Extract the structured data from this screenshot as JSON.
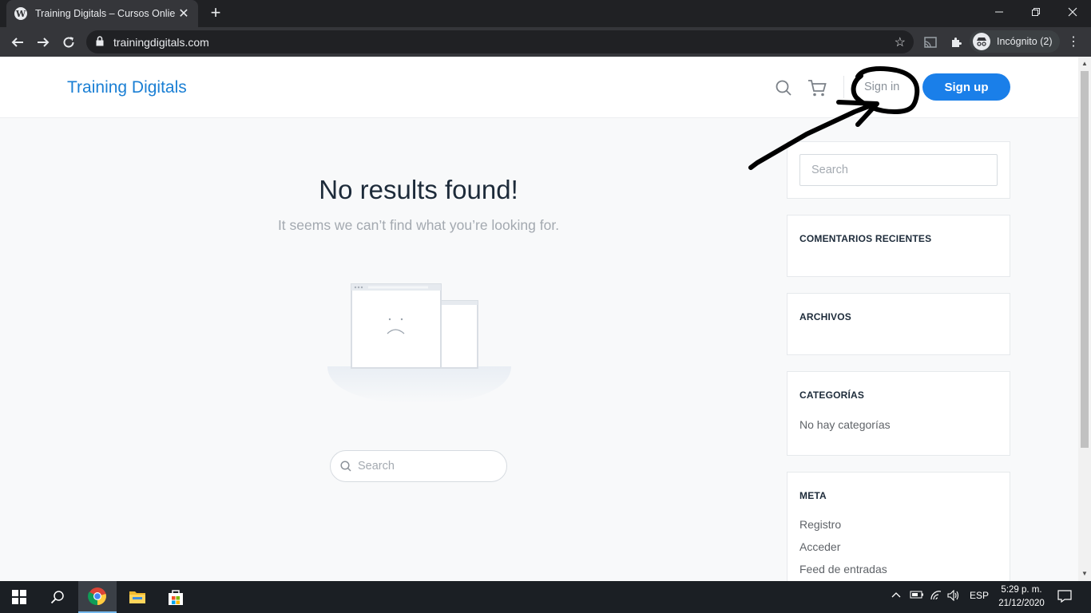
{
  "browser": {
    "tab_title": "Training Digitals – Cursos Onlie",
    "tab_close": "✕",
    "new_tab": "+",
    "url": "trainingdigitals.com",
    "profile_label": "Incógnito (2)",
    "icons": [
      "back-icon",
      "forward-icon",
      "reload-icon",
      "lock-icon",
      "star-icon",
      "cast-icon",
      "extensions-icon",
      "incognito-icon",
      "menu-icon"
    ]
  },
  "site": {
    "brand": "Training Digitals",
    "signin": "Sign in",
    "signup": "Sign up",
    "accent": "#1a7fe9"
  },
  "main": {
    "title": "No results found!",
    "subtitle": "It seems we can’t find what you’re looking for.",
    "search_placeholder": "Search"
  },
  "sidebar": {
    "search_placeholder": "Search",
    "recent_comments_title": "COMENTARIOS RECIENTES",
    "archives_title": "ARCHIVOS",
    "categories_title": "CATEGORÍAS",
    "categories_empty": "No hay categorías",
    "meta_title": "META",
    "meta_links": [
      "Registro",
      "Acceder",
      "Feed de entradas"
    ]
  },
  "taskbar": {
    "lang": "ESP",
    "time": "5:29 p. m.",
    "date": "21/12/2020"
  }
}
